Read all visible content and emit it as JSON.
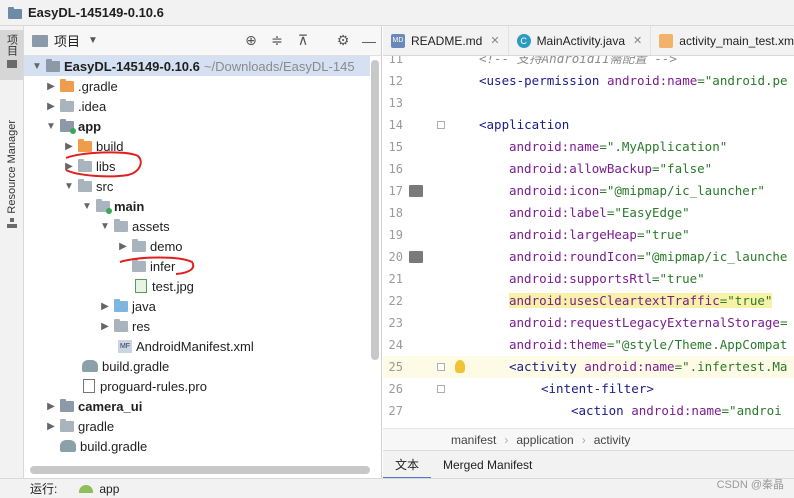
{
  "window": {
    "title": "EasyDL-145149-0.10.6"
  },
  "left_strip": {
    "project_tab": "项目",
    "resource_tab": "Resource Manager"
  },
  "project_panel": {
    "view_label": "项目"
  },
  "tree": [
    {
      "label": "EasyDL-145149-0.10.6",
      "path": "~/Downloads/EasyDL-145",
      "bold": true
    },
    {
      "label": ".gradle"
    },
    {
      "label": ".idea"
    },
    {
      "label": "app",
      "bold": true
    },
    {
      "label": "build"
    },
    {
      "label": "libs"
    },
    {
      "label": "src"
    },
    {
      "label": "main",
      "bold": true
    },
    {
      "label": "assets"
    },
    {
      "label": "demo"
    },
    {
      "label": "infer"
    },
    {
      "label": "test.jpg"
    },
    {
      "label": "java"
    },
    {
      "label": "res"
    },
    {
      "label": "AndroidManifest.xml"
    },
    {
      "label": "build.gradle"
    },
    {
      "label": "proguard-rules.pro"
    },
    {
      "label": "camera_ui",
      "bold": true
    },
    {
      "label": "gradle"
    },
    {
      "label": "build.gradle"
    }
  ],
  "editor": {
    "tabs": [
      {
        "label": "README.md",
        "icon": "MD"
      },
      {
        "label": "MainActivity.java",
        "icon": "C"
      },
      {
        "label": "activity_main_test.xm",
        "icon": ""
      }
    ],
    "lines": [
      {
        "num": "11",
        "text": "<!-- 支持Android11需配置 -->"
      },
      {
        "num": "12",
        "tag": "<uses-permission",
        "attr": "android:name",
        "val": "=\"android.pe"
      },
      {
        "num": "13"
      },
      {
        "num": "14",
        "tag": "<application"
      },
      {
        "num": "15",
        "attr": "android:name",
        "val": "=\".MyApplication\""
      },
      {
        "num": "16",
        "attr": "android:allowBackup",
        "val": "=\"false\""
      },
      {
        "num": "17",
        "attr": "android:icon",
        "val": "=\"@mipmap/ic_launcher\""
      },
      {
        "num": "18",
        "attr": "android:label",
        "val": "=\"EasyEdge\""
      },
      {
        "num": "19",
        "attr": "android:largeHeap",
        "val": "=\"true\""
      },
      {
        "num": "20",
        "attr": "android:roundIcon",
        "val": "=\"@mipmap/ic_launche"
      },
      {
        "num": "21",
        "attr": "android:supportsRtl",
        "val": "=\"true\""
      },
      {
        "num": "22",
        "attr": "android:usesCleartextTraffic",
        "val": "=\"true\""
      },
      {
        "num": "23",
        "attr": "android:requestLegacyExternalStorage",
        "val": "="
      },
      {
        "num": "24",
        "attr": "android:theme",
        "val": "=\"@style/Theme.AppCompat"
      },
      {
        "num": "25",
        "tag": "<activity",
        "attr": "android:name",
        "val": "=\".infertest.Ma"
      },
      {
        "num": "26",
        "tag": "<intent-filter>"
      },
      {
        "num": "27",
        "tag": "<action",
        "attr": "android:name",
        "val": "=\"androi"
      }
    ],
    "breadcrumb": [
      "manifest",
      "application",
      "activity"
    ],
    "subtabs": [
      "文本",
      "Merged Manifest"
    ]
  },
  "bottom": {
    "run_label": "运行:",
    "run_config": "app"
  },
  "watermark": "CSDN @秦晶",
  "colors": {
    "selection": "#d5e1f2",
    "annotation": "#e02020"
  }
}
